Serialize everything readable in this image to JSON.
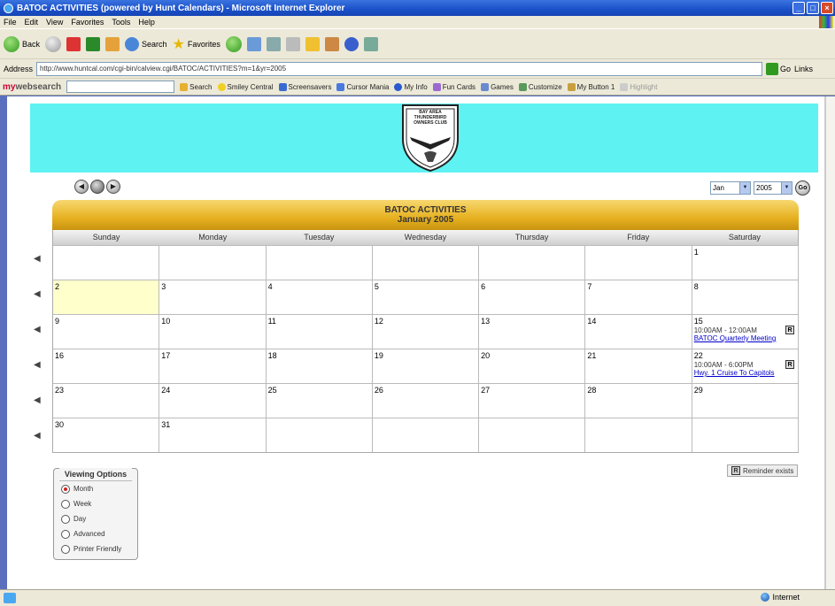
{
  "window": {
    "title": "BATOC ACTIVITIES (powered by Hunt Calendars) - Microsoft Internet Explorer"
  },
  "menu": [
    "File",
    "Edit",
    "View",
    "Favorites",
    "Tools",
    "Help"
  ],
  "toolbar": {
    "back": "Back",
    "search": "Search",
    "favorites": "Favorites"
  },
  "address": {
    "label": "Address",
    "url": "http://www.huntcal.com/cgi-bin/calview.cgi/BATOC/ACTIVITIES?m=1&yr=2005",
    "go": "Go",
    "links": "Links"
  },
  "searchbar": {
    "brand_prefix": "my",
    "brand_suffix": "websearch",
    "items": [
      "Search",
      "Smiley Central",
      "Screensavers",
      "Cursor Mania",
      "My Info",
      "Fun Cards",
      "Games",
      "Customize",
      "My Button 1",
      "Highlight"
    ]
  },
  "page": {
    "logo_lines": [
      "BAY AREA",
      "THUNDERBIRD",
      "OWNERS CLUB"
    ],
    "month_select": "Jan",
    "year_select": "2005",
    "go_label": "Go",
    "calendar_title": "BATOC ACTIVITIES",
    "calendar_subtitle": "January 2005",
    "days": [
      "Sunday",
      "Monday",
      "Tuesday",
      "Wednesday",
      "Thursday",
      "Friday",
      "Saturday"
    ],
    "weeks": [
      [
        {
          "num": ""
        },
        {
          "num": ""
        },
        {
          "num": ""
        },
        {
          "num": ""
        },
        {
          "num": ""
        },
        {
          "num": ""
        },
        {
          "num": "1"
        }
      ],
      [
        {
          "num": "2",
          "today": true
        },
        {
          "num": "3"
        },
        {
          "num": "4"
        },
        {
          "num": "5"
        },
        {
          "num": "6"
        },
        {
          "num": "7"
        },
        {
          "num": "8"
        }
      ],
      [
        {
          "num": "9"
        },
        {
          "num": "10"
        },
        {
          "num": "11"
        },
        {
          "num": "12"
        },
        {
          "num": "13"
        },
        {
          "num": "14"
        },
        {
          "num": "15",
          "time": "10:00AM - 12:00AM",
          "link": "BATOC Quarterly Meeting",
          "reminder": "R"
        }
      ],
      [
        {
          "num": "16"
        },
        {
          "num": "17"
        },
        {
          "num": "18"
        },
        {
          "num": "19"
        },
        {
          "num": "20"
        },
        {
          "num": "21"
        },
        {
          "num": "22",
          "time": "10:00AM - 6:00PM",
          "link": "Hwy. 1 Cruise To Capitols",
          "reminder": "R"
        }
      ],
      [
        {
          "num": "23"
        },
        {
          "num": "24"
        },
        {
          "num": "25"
        },
        {
          "num": "26"
        },
        {
          "num": "27"
        },
        {
          "num": "28"
        },
        {
          "num": "29"
        }
      ],
      [
        {
          "num": "30"
        },
        {
          "num": "31"
        },
        {
          "num": ""
        },
        {
          "num": ""
        },
        {
          "num": ""
        },
        {
          "num": ""
        },
        {
          "num": ""
        }
      ]
    ],
    "reminder_legend": "Reminder exists",
    "reminder_letter": "R",
    "viewing_title": "Viewing Options",
    "viewing_options": [
      {
        "label": "Month",
        "selected": true
      },
      {
        "label": "Week",
        "selected": false
      },
      {
        "label": "Day",
        "selected": false
      },
      {
        "label": "Advanced",
        "selected": false
      },
      {
        "label": "Printer Friendly",
        "selected": false
      }
    ]
  },
  "status": {
    "zone": "Internet"
  },
  "colors": {
    "banner": "#5ff2f2",
    "header_gold": "#e6b020",
    "today": "#ffffcc",
    "link": "#0000cc"
  }
}
